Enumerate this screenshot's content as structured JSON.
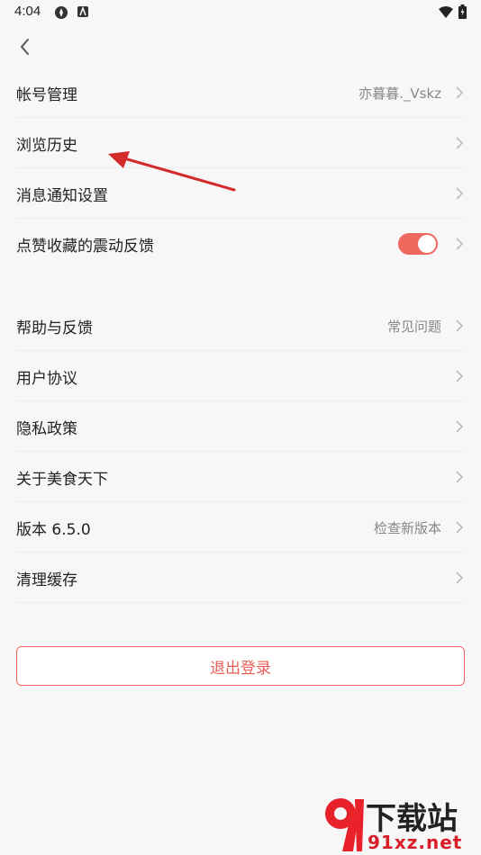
{
  "status_bar": {
    "time": "4:04"
  },
  "settings_group_1": [
    {
      "label": "帐号管理",
      "value": "亦暮暮._Vskz"
    },
    {
      "label": "浏览历史",
      "value": ""
    },
    {
      "label": "消息通知设置",
      "value": ""
    },
    {
      "label": "点赞收藏的震动反馈",
      "toggle": true
    }
  ],
  "settings_group_2": [
    {
      "label": "帮助与反馈",
      "value": "常见问题"
    },
    {
      "label": "用户协议",
      "value": ""
    },
    {
      "label": "隐私政策",
      "value": ""
    },
    {
      "label": "关于美食天下",
      "value": ""
    },
    {
      "label": "版本 6.5.0",
      "value": "检查新版本"
    },
    {
      "label": "清理缓存",
      "value": ""
    }
  ],
  "logout": {
    "label": "退出登录"
  },
  "watermark": {
    "top": "下载站",
    "bottom": "91xz.net"
  },
  "colors": {
    "accent": "#f0675e",
    "arrow": "#d42a2a",
    "background": "#f7f7f7"
  },
  "icons": [
    "back-arrow-icon",
    "chevron-right-icon",
    "wifi-icon",
    "battery-icon"
  ]
}
